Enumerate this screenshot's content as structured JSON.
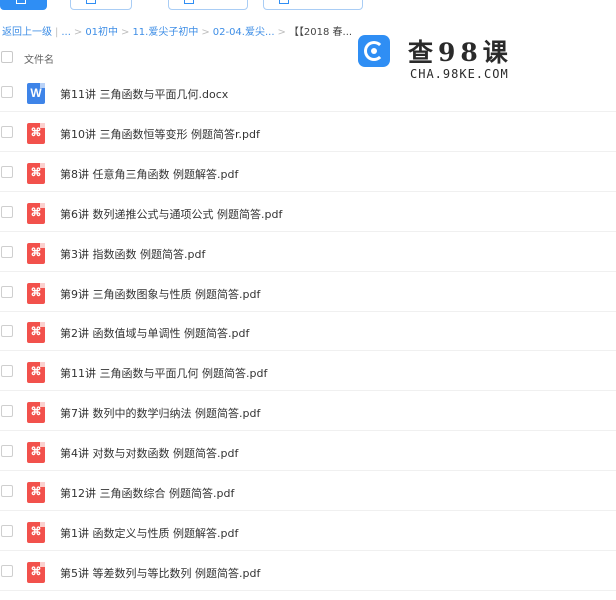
{
  "breadcrumb": {
    "back": "返回上一级",
    "ellipsis": "...",
    "items": [
      "01初中",
      "11.爱尖子初中",
      "02-04.爱尖...",
      "【【2018 春..."
    ]
  },
  "watermark": {
    "title": "查98课",
    "subtitle": "CHA.98KE.COM"
  },
  "header": {
    "filename_label": "文件名"
  },
  "files": [
    {
      "name": "第11讲 三角函数与平面几何.docx",
      "type": "docx",
      "icon": "word-icon"
    },
    {
      "name": "第10讲 三角函数恒等变形 例题简答r.pdf",
      "type": "pdf",
      "icon": "pdf-icon"
    },
    {
      "name": "第8讲 任意角三角函数 例题解答.pdf",
      "type": "pdf",
      "icon": "pdf-icon"
    },
    {
      "name": "第6讲 数列递推公式与通项公式 例题简答.pdf",
      "type": "pdf",
      "icon": "pdf-icon"
    },
    {
      "name": "第3讲 指数函数 例题简答.pdf",
      "type": "pdf",
      "icon": "pdf-icon"
    },
    {
      "name": "第9讲 三角函数图象与性质 例题简答.pdf",
      "type": "pdf",
      "icon": "pdf-icon"
    },
    {
      "name": "第2讲 函数值域与单调性 例题简答.pdf",
      "type": "pdf",
      "icon": "pdf-icon"
    },
    {
      "name": "第11讲 三角函数与平面几何 例题简答.pdf",
      "type": "pdf",
      "icon": "pdf-icon"
    },
    {
      "name": "第7讲 数列中的数学归纳法 例题简答.pdf",
      "type": "pdf",
      "icon": "pdf-icon"
    },
    {
      "name": "第4讲 对数与对数函数 例题简答.pdf",
      "type": "pdf",
      "icon": "pdf-icon"
    },
    {
      "name": "第12讲 三角函数综合 例题简答.pdf",
      "type": "pdf",
      "icon": "pdf-icon"
    },
    {
      "name": "第1讲 函数定义与性质 例题解答.pdf",
      "type": "pdf",
      "icon": "pdf-icon"
    },
    {
      "name": "第5讲 等差数列与等比数列 例题简答.pdf",
      "type": "pdf",
      "icon": "pdf-icon"
    }
  ],
  "colors": {
    "accent": "#2f8ef4",
    "pdf": "#f2514c",
    "docx": "#3e84e8"
  }
}
